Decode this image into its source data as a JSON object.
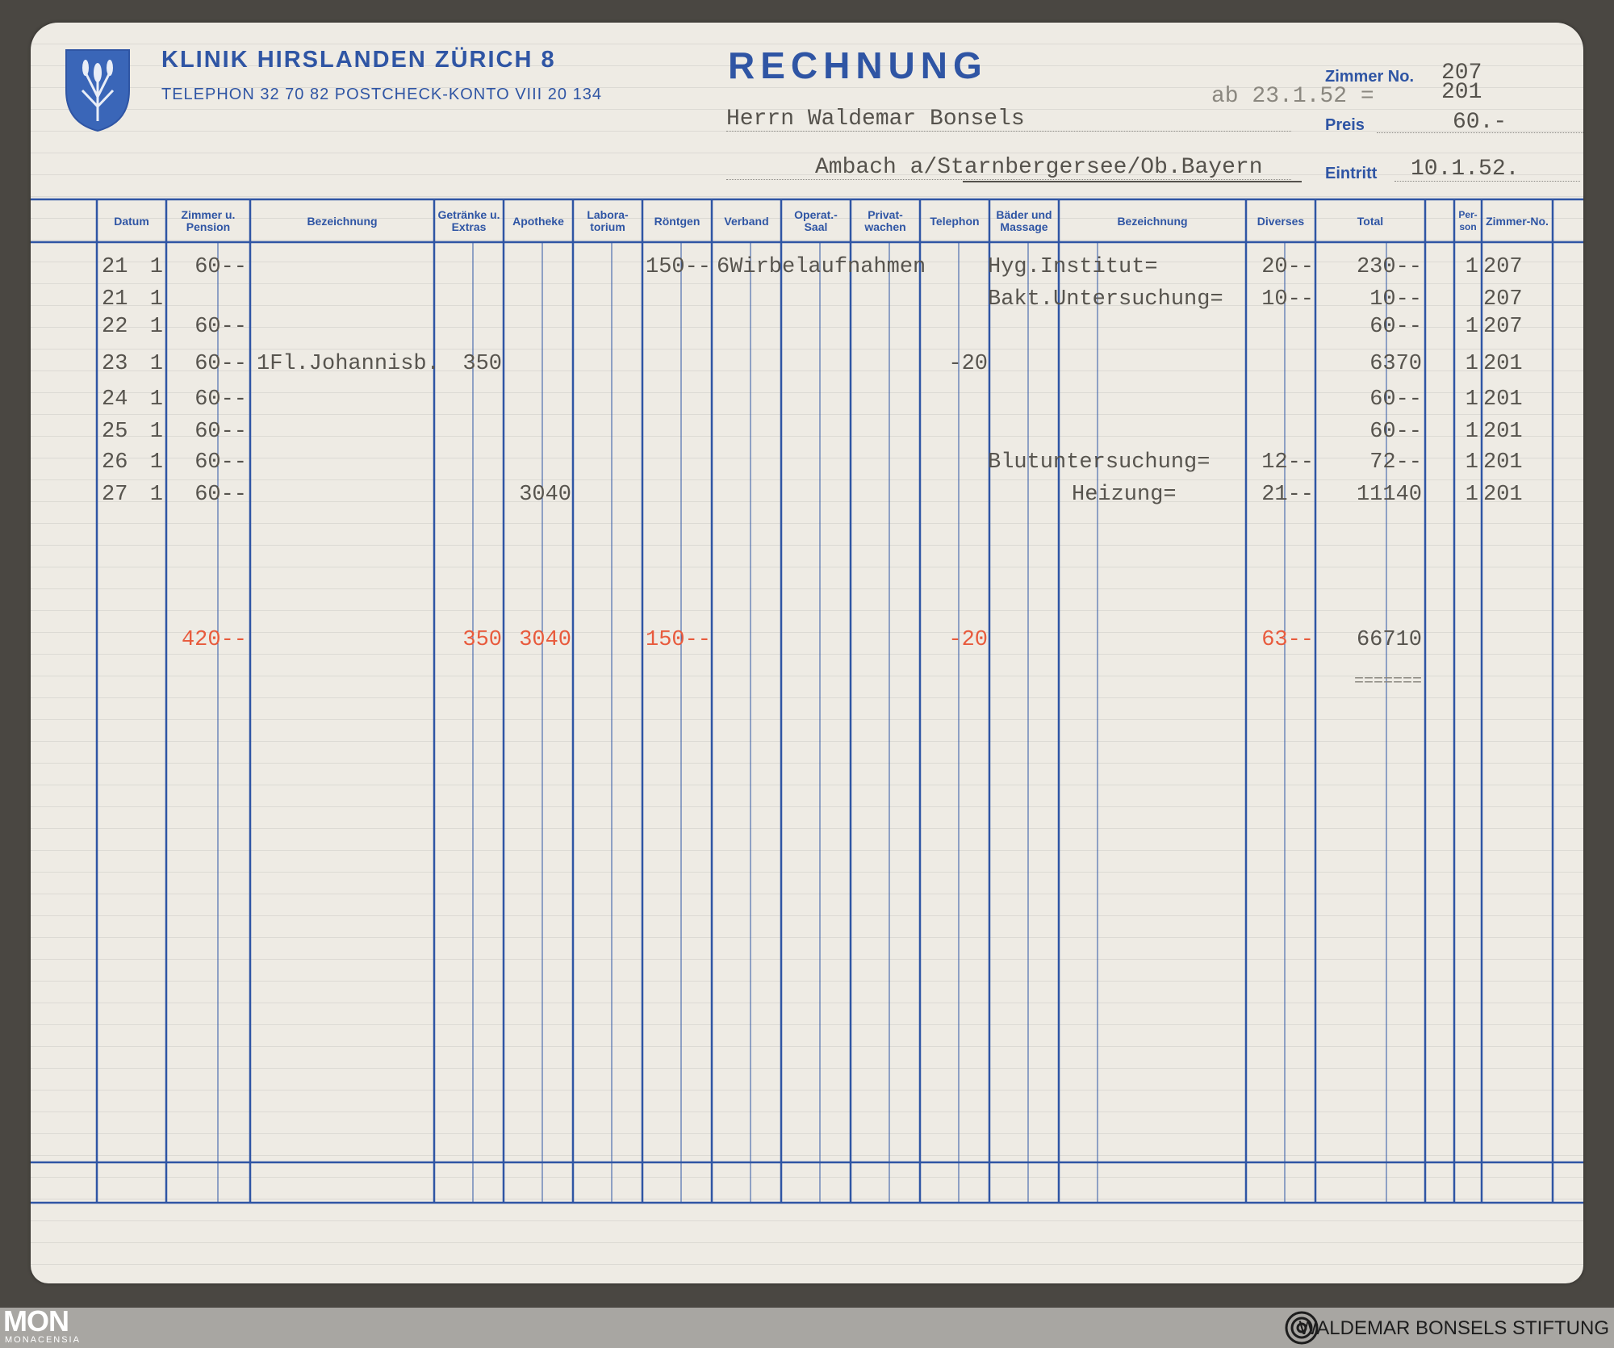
{
  "header": {
    "clinic_name": "KLINIK HIRSLANDEN ZÜRICH 8",
    "contact": "TELEPHON 32 70 82   POSTCHECK-KONTO VIII 20 134",
    "title": "RECHNUNG",
    "recipient": "Herrn Waldemar Bonsels",
    "address": "Ambach a/Starnbergersee/Ob.Bayern",
    "from_note": "ab 23.1.52 =",
    "zimmer_label": "Zimmer No.",
    "zimmer_values": [
      "207",
      "201"
    ],
    "preis_label": "Preis",
    "preis_value": "60.-",
    "eintritt_label": "Eintritt",
    "eintritt_value": "10.1.52."
  },
  "columns": {
    "datum": "Datum",
    "zimmer_pension": "Zimmer u. Pension",
    "bezeichnung1": "Bezeichnung",
    "getraenke": "Getränke u. Extras",
    "apotheke": "Apotheke",
    "laboratorium": "Labora-torium",
    "roentgen": "Röntgen",
    "verband": "Verband",
    "operat_saal": "Operat.- Saal",
    "privatwachen": "Privat-wachen",
    "telephon": "Telephon",
    "baeder": "Bäder und Massage",
    "bezeichnung2": "Bezeichnung",
    "diverses": "Diverses",
    "total": "Total",
    "person": "Per-son",
    "zimmer_no": "Zimmer-No."
  },
  "rows": [
    {
      "d": "21",
      "m": "1",
      "pension": "60--",
      "bez1": "",
      "getraenke": "",
      "apotheke": "",
      "roentgen": "150--",
      "roentgen_note": "6Wirbelaufnahmen",
      "telephon": "",
      "bez2": "Hyg.Institut=",
      "diverses": "20--",
      "total": "230--",
      "person": "1",
      "zimmer": "207"
    },
    {
      "d": "21",
      "m": "1",
      "pension": "",
      "bez1": "",
      "getraenke": "",
      "apotheke": "",
      "roentgen": "",
      "roentgen_note": "",
      "telephon": "",
      "bez2": "Bakt.Untersuchung=",
      "diverses": "10--",
      "total": "10--",
      "person": "",
      "zimmer": "207"
    },
    {
      "d": "22",
      "m": "1",
      "pension": "60--",
      "bez1": "",
      "getraenke": "",
      "apotheke": "",
      "roentgen": "",
      "roentgen_note": "",
      "telephon": "",
      "bez2": "",
      "diverses": "",
      "total": "60--",
      "person": "1",
      "zimmer": "207"
    },
    {
      "d": "23",
      "m": "1",
      "pension": "60--",
      "bez1": "1Fl.Johannisb.",
      "getraenke": "350",
      "apotheke": "",
      "roentgen": "",
      "roentgen_note": "",
      "telephon": "-20",
      "bez2": "",
      "diverses": "",
      "total": "6370",
      "person": "1",
      "zimmer": "201"
    },
    {
      "d": "24",
      "m": "1",
      "pension": "60--",
      "bez1": "",
      "getraenke": "",
      "apotheke": "",
      "roentgen": "",
      "roentgen_note": "",
      "telephon": "",
      "bez2": "",
      "diverses": "",
      "total": "60--",
      "person": "1",
      "zimmer": "201"
    },
    {
      "d": "25",
      "m": "1",
      "pension": "60--",
      "bez1": "",
      "getraenke": "",
      "apotheke": "",
      "roentgen": "",
      "roentgen_note": "",
      "telephon": "",
      "bez2": "",
      "diverses": "",
      "total": "60--",
      "person": "1",
      "zimmer": "201"
    },
    {
      "d": "26",
      "m": "1",
      "pension": "60--",
      "bez1": "",
      "getraenke": "",
      "apotheke": "",
      "roentgen": "",
      "roentgen_note": "",
      "telephon": "",
      "bez2": "Blutuntersuchung=",
      "diverses": "12--",
      "total": "72--",
      "person": "1",
      "zimmer": "201"
    },
    {
      "d": "27",
      "m": "1",
      "pension": "60--",
      "bez1": "",
      "getraenke": "",
      "apotheke": "3040",
      "roentgen": "",
      "roentgen_note": "",
      "telephon": "",
      "bez2": "Heizung=",
      "diverses": "21--",
      "total": "11140",
      "person": "1",
      "zimmer": "201"
    }
  ],
  "totals": {
    "pension": "420--",
    "getraenke": "350",
    "apotheke": "3040",
    "roentgen": "150--",
    "telephon": "-20",
    "diverses": "63--",
    "total": "66710",
    "underline": "======="
  },
  "footer": {
    "left_logo": "MON",
    "left_sub": "MONACENSIA",
    "right_text": "WALDEMAR BONSELS STIFTUNG"
  },
  "colors": {
    "print_blue": "#2f55a4",
    "type_gray": "#55524c",
    "red_ink": "#e85a3c",
    "paper": "#eeebe4"
  }
}
